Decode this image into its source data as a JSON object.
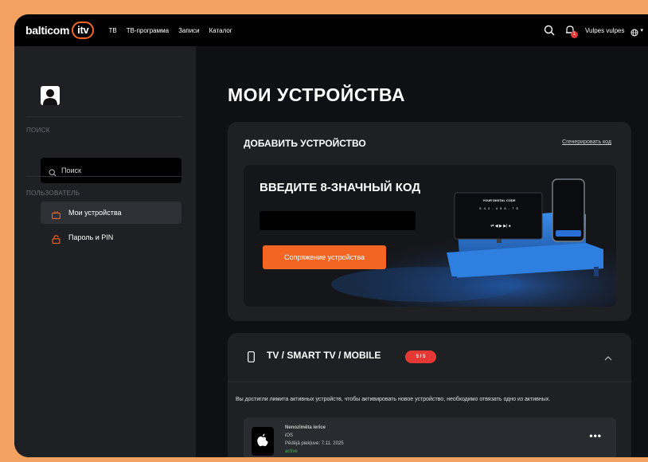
{
  "header": {
    "logo_text": "balticom",
    "logo_itv": "itv",
    "nav": [
      "ТВ",
      "ТВ-программа",
      "Записи",
      "Каталог"
    ],
    "notification_count": "1",
    "username": "Vulpes vulpes"
  },
  "sidebar": {
    "search_section": "ПОИСК",
    "search_placeholder": "Поиск",
    "user_section": "ПОЛЬЗОВАТЕЛЬ",
    "items": [
      {
        "label": "Мои устройства",
        "icon": "tv-icon",
        "active": true
      },
      {
        "label": "Пароль и PIN",
        "icon": "lock-icon",
        "active": false
      }
    ]
  },
  "main": {
    "title": "МОИ УСТРОЙСТВА",
    "add_device": {
      "title": "ДОБАВИТЬ УСТРОЙСТВО",
      "generate_link": "Сгенерировать код",
      "banner_title": "ВВЕДИТЕ 8-ЗНАЧНЫЙ КОД",
      "code_value": "",
      "pair_button": "Сопряжение устройства",
      "illustration_tv_text": "YOUR DIGITAL CODE",
      "illustration_code": "5 4 2 - 4 5 8 - 7 5"
    },
    "devices_section": {
      "title": "TV / SMART TV / MOBILE",
      "count_badge": "5 / 5",
      "limit_notice": "Вы достигли лимита активных устройств, чтобы активировать новое устройство, необходимо отвязать одно из активных.",
      "devices": [
        {
          "name": "Nenozīmēta ierīce",
          "os": "iOS",
          "last_login": "Pēdējā piekļuve: 7.11. 2025",
          "status": "active"
        }
      ]
    }
  },
  "colors": {
    "accent": "#f26522",
    "outer_bg": "#f4a261",
    "badge": "#e53935",
    "status_active": "#4caf50"
  }
}
